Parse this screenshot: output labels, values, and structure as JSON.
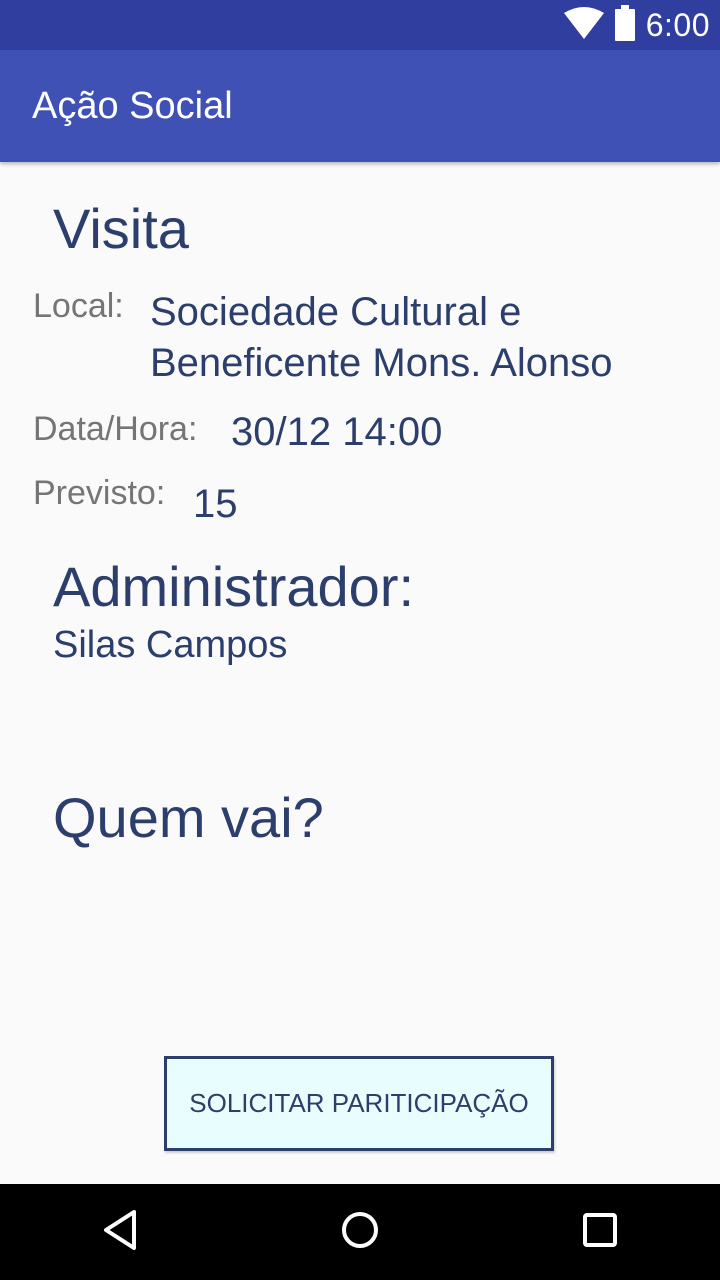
{
  "status_bar": {
    "time": "6:00",
    "icons": [
      "wifi-icon",
      "battery-icon"
    ],
    "background": "#303f9f"
  },
  "app_bar": {
    "title": "Ação Social",
    "background": "#3f51b5"
  },
  "event": {
    "title": "Visita",
    "local_label": "Local:",
    "local_value": "Sociedade Cultural e Beneficente Mons. Alonso",
    "datahora_label": "Data/Hora:",
    "datahora_value": "30/12 14:00",
    "previsto_label": "Previsto:",
    "previsto_value": "15"
  },
  "admin": {
    "heading": "Administrador:",
    "name": "Silas Campos"
  },
  "participants": {
    "heading": "Quem vai?"
  },
  "action": {
    "button_label": "SOLICITAR PARITICIPAÇÃO",
    "border_color": "#2c3e6b",
    "background": "#e8fdfd"
  },
  "nav_bar": {
    "icons": [
      "back-icon",
      "home-icon",
      "recents-icon"
    ]
  },
  "colors": {
    "text_primary": "#2c3e6b",
    "text_label": "#757575",
    "page_background": "#fafafa"
  }
}
